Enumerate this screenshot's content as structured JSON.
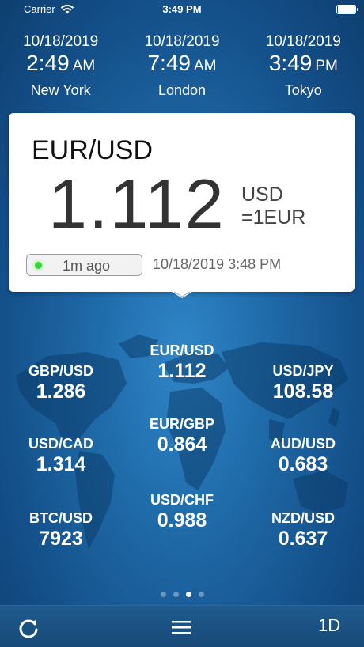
{
  "status": {
    "carrier": "Carrier",
    "time": "3:49 PM"
  },
  "cities": [
    {
      "date": "10/18/2019",
      "time": "2:49",
      "ampm": "AM",
      "name": "New York"
    },
    {
      "date": "10/18/2019",
      "time": "7:49",
      "ampm": "AM",
      "name": "London"
    },
    {
      "date": "10/18/2019",
      "time": "3:49",
      "ampm": "PM",
      "name": "Tokyo"
    }
  ],
  "card": {
    "pair": "EUR/USD",
    "rate": "1.112",
    "unit": "USD",
    "base": "=1EUR",
    "age": "1m ago",
    "updated": "10/18/2019 3:48 PM"
  },
  "rates": [
    {
      "pair": "EUR/USD",
      "value": "1.112"
    },
    {
      "pair": "GBP/USD",
      "value": "1.286"
    },
    {
      "pair": "USD/JPY",
      "value": "108.58"
    },
    {
      "pair": "EUR/GBP",
      "value": "0.864"
    },
    {
      "pair": "USD/CAD",
      "value": "1.314"
    },
    {
      "pair": "AUD/USD",
      "value": "0.683"
    },
    {
      "pair": "USD/CHF",
      "value": "0.988"
    },
    {
      "pair": "BTC/USD",
      "value": "7923"
    },
    {
      "pair": "NZD/USD",
      "value": "0.637"
    }
  ],
  "pager": {
    "count": 4,
    "active": 2
  },
  "toolbar": {
    "refresh_icon": "refresh-icon",
    "menu_icon": "menu-icon",
    "range_label": "1D"
  },
  "colors": {
    "accent_green": "#3cd23c",
    "background": "#1f6aa8"
  }
}
